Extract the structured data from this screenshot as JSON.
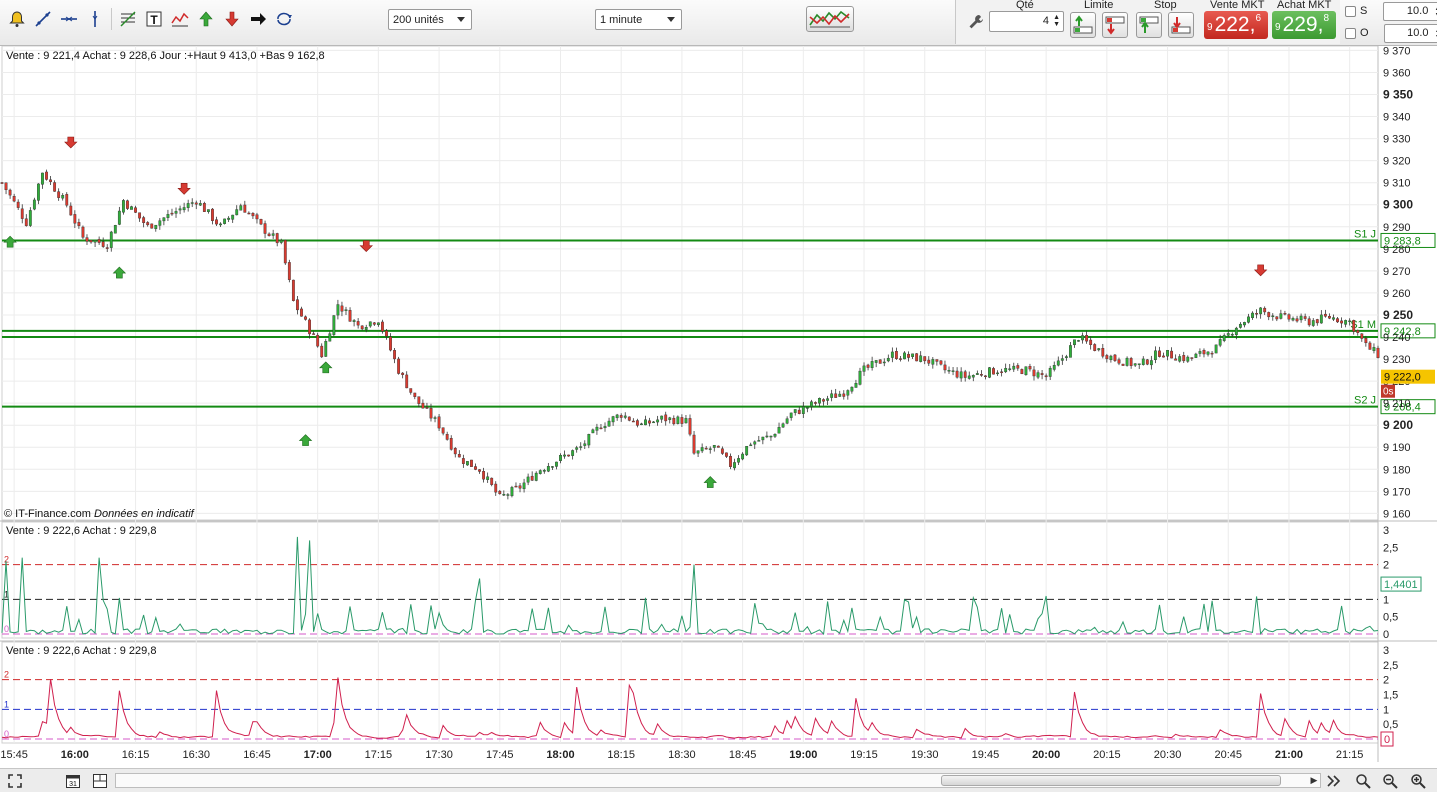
{
  "toolbar": {
    "tools": [
      "bell-icon",
      "trendline-icon",
      "horizontal-line-icon",
      "vertical-line-icon",
      "fibonacci-icon",
      "text-tool-icon",
      "indicator-icon",
      "buy-arrow-icon",
      "sell-arrow-icon",
      "pointer-arrow-icon",
      "cycle-icon"
    ],
    "units_select": "200 unités",
    "period_select": "1 minute",
    "strategy_icon": "strategy-icon"
  },
  "order_panel": {
    "qty_label": "Qté",
    "qty_value": "4",
    "limit_label": "Limite",
    "stop_label": "Stop",
    "sell_mkt_label": "Vente MKT",
    "buy_mkt_label": "Achat MKT",
    "sell_price_prefix": "9",
    "sell_price_main": "222,",
    "sell_price_sup": "6",
    "buy_price_prefix": "9",
    "buy_price_main": "229,",
    "buy_price_sup": "8",
    "s_label": "S",
    "s_value": "10.0",
    "o_label": "O",
    "o_value": "10.0"
  },
  "main_chart": {
    "info": "Vente : 9 221,4 Achat : 9 228,6 Jour :+Haut 9 413,0 +Bas 9 162,8",
    "credit_source": "© IT-Finance.com",
    "credit_note": "Données en indicatif",
    "y_ticks": [
      "9 370",
      "9 360",
      "9 350",
      "9 340",
      "9 330",
      "9 320",
      "9 310",
      "9 300",
      "9 290",
      "9 280",
      "9 270",
      "9 260",
      "9 250",
      "9 240",
      "9 230",
      "9 220",
      "9 210",
      "9 200",
      "9 190",
      "9 180",
      "9 170",
      "9 160"
    ],
    "y_bold": [
      "9 350",
      "9 300",
      "9 250",
      "9 200"
    ],
    "levels": [
      {
        "label": "S1 J",
        "value": 9283.8,
        "tag": "9 283,8"
      },
      {
        "label": "S1 M",
        "value": 9242.8,
        "tag": "9 242,8"
      },
      {
        "label": "",
        "value": 9240.0,
        "tag": ""
      },
      {
        "label": "S2 J",
        "value": 9208.4,
        "tag": "9 208,4"
      }
    ],
    "last_price_tag": "9 222,0",
    "countdown_tag": "0s",
    "colors": {
      "up": "#2fae3a",
      "down": "#d93a2f",
      "level": "#138a13",
      "sell_arrow": "#d63a32",
      "buy_arrow": "#3aa83a"
    }
  },
  "indicator1": {
    "info": "Vente : 9 222,6 Achat : 9 229,8",
    "y_ticks": [
      "3",
      "2,5",
      "2",
      "1,5",
      "1",
      "0,5",
      "0"
    ],
    "left_levels": [
      "2",
      "1",
      "0"
    ],
    "value_tag": "1,4401",
    "color": "#2a9a6a"
  },
  "indicator2": {
    "info": "Vente : 9 222,6 Achat : 9 229,8",
    "y_ticks": [
      "3",
      "2,5",
      "2",
      "1,5",
      "1",
      "0,5",
      "0"
    ],
    "left_levels": [
      "2",
      "1",
      "0"
    ],
    "value_tag": "0",
    "color": "#d0204e"
  },
  "x_axis": {
    "labels": [
      "15:45",
      "16:00",
      "16:15",
      "16:30",
      "16:45",
      "17:00",
      "17:15",
      "17:30",
      "17:45",
      "18:00",
      "18:15",
      "18:30",
      "18:45",
      "19:00",
      "19:15",
      "19:30",
      "19:45",
      "20:00",
      "20:15",
      "20:30",
      "20:45",
      "21:00",
      "21:15"
    ],
    "bold": [
      "16:00",
      "17:00",
      "18:00",
      "19:00",
      "20:00",
      "21:00"
    ]
  },
  "chart_data": {
    "type": "candlestick",
    "period": "1 minute",
    "x_range": [
      "15:42",
      "21:22"
    ],
    "y_range": [
      9157,
      9372
    ],
    "close_path": [
      [
        "15:42",
        9310
      ],
      [
        "15:48",
        9292
      ],
      [
        "15:52",
        9315
      ],
      [
        "15:58",
        9300
      ],
      [
        "16:02",
        9285
      ],
      [
        "16:08",
        9282
      ],
      [
        "16:12",
        9302
      ],
      [
        "16:18",
        9290
      ],
      [
        "16:25",
        9297
      ],
      [
        "16:30",
        9302
      ],
      [
        "16:36",
        9290
      ],
      [
        "16:41",
        9300
      ],
      [
        "16:46",
        9290
      ],
      [
        "16:51",
        9282
      ],
      [
        "16:54",
        9256
      ],
      [
        "16:59",
        9240
      ],
      [
        "17:01",
        9232
      ],
      [
        "17:05",
        9255
      ],
      [
        "17:10",
        9245
      ],
      [
        "17:15",
        9248
      ],
      [
        "17:20",
        9225
      ],
      [
        "17:24",
        9212
      ],
      [
        "17:30",
        9200
      ],
      [
        "17:35",
        9185
      ],
      [
        "17:40",
        9180
      ],
      [
        "17:45",
        9167
      ],
      [
        "17:50",
        9172
      ],
      [
        "17:55",
        9180
      ],
      [
        "18:00",
        9185
      ],
      [
        "18:05",
        9190
      ],
      [
        "18:10",
        9200
      ],
      [
        "18:15",
        9205
      ],
      [
        "18:20",
        9200
      ],
      [
        "18:25",
        9203
      ],
      [
        "18:31",
        9202
      ],
      [
        "18:33",
        9187
      ],
      [
        "18:38",
        9190
      ],
      [
        "18:42",
        9182
      ],
      [
        "18:47",
        9192
      ],
      [
        "18:52",
        9195
      ],
      [
        "18:57",
        9205
      ],
      [
        "19:03",
        9210
      ],
      [
        "19:10",
        9215
      ],
      [
        "19:15",
        9225
      ],
      [
        "19:22",
        9232
      ],
      [
        "19:30",
        9230
      ],
      [
        "19:35",
        9225
      ],
      [
        "19:40",
        9222
      ],
      [
        "19:48",
        9225
      ],
      [
        "19:55",
        9225
      ],
      [
        "20:00",
        9222
      ],
      [
        "20:03",
        9228
      ],
      [
        "20:08",
        9240
      ],
      [
        "20:12",
        9235
      ],
      [
        "20:17",
        9230
      ],
      [
        "20:23",
        9227
      ],
      [
        "20:28",
        9233
      ],
      [
        "20:35",
        9230
      ],
      [
        "20:42",
        9235
      ],
      [
        "20:47",
        9245
      ],
      [
        "20:53",
        9252
      ],
      [
        "20:58",
        9249
      ],
      [
        "21:05",
        9247
      ],
      [
        "21:10",
        9249
      ],
      [
        "21:15",
        9247
      ],
      [
        "21:19",
        9236
      ],
      [
        "21:22",
        9232
      ]
    ],
    "day_high": "9 413,0",
    "day_low": "9 162,8",
    "signals": [
      {
        "type": "sell",
        "time": "15:59",
        "price_ref": 9328
      },
      {
        "type": "sell",
        "time": "16:27",
        "price_ref": 9307
      },
      {
        "type": "sell",
        "time": "17:12",
        "price_ref": 9281
      },
      {
        "type": "sell",
        "time": "20:53",
        "price_ref": 9270
      },
      {
        "type": "buy",
        "time": "15:44",
        "price_ref": 9283
      },
      {
        "type": "buy",
        "time": "16:11",
        "price_ref": 9269
      },
      {
        "type": "buy",
        "time": "17:02",
        "price_ref": 9226
      },
      {
        "type": "buy",
        "time": "16:57",
        "price_ref": 9193
      },
      {
        "type": "buy",
        "time": "18:37",
        "price_ref": 9174
      }
    ]
  }
}
